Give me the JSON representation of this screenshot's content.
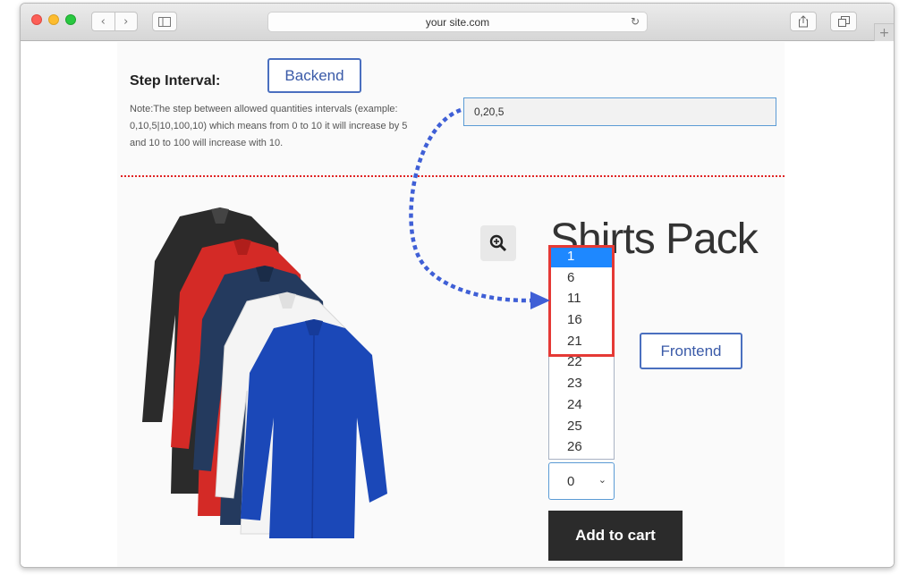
{
  "browser": {
    "url": "your site.com",
    "icons": {
      "back": "chevron-left-icon",
      "forward": "chevron-right-icon",
      "sidebar": "sidebar-icon",
      "reload": "reload-icon",
      "share": "share-icon",
      "tabs": "tabs-icon",
      "new_tab": "plus-icon"
    }
  },
  "backend": {
    "callout": "Backend",
    "step_label": "Step Interval:",
    "note": "Note:The step between allowed quantities intervals (example: 0,10,5|10,100,10) which means from 0 to 10 it will increase by 5 and 10 to 100 will increase with 10.",
    "step_value": "0,20,5"
  },
  "frontend": {
    "callout": "Frontend",
    "product_title": "Shirts Pack",
    "quantity_options": [
      "1",
      "6",
      "11",
      "16",
      "21",
      "22",
      "23",
      "24",
      "25",
      "26"
    ],
    "selected_option": "1",
    "quantity_value": "0",
    "add_to_cart": "Add to cart"
  },
  "colors": {
    "callout_border": "#4a6fbf",
    "highlight_box": "#e53935",
    "divider": "#e02424",
    "selected_option_bg": "#1e88ff",
    "arrow": "#3f5fd6",
    "button_bg": "#2b2b2b"
  }
}
